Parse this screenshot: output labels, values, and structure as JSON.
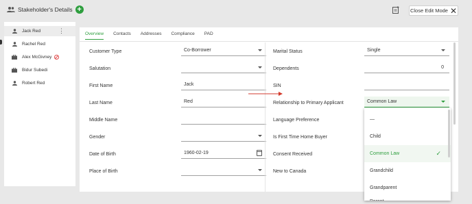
{
  "header": {
    "title": "Stakeholder's Details",
    "close_label": "Close Edit Mode"
  },
  "stakeholders": [
    {
      "name": "Jack Red",
      "icon": "person-icon",
      "selected": true
    },
    {
      "name": "Rachel Red",
      "icon": "person-icon"
    },
    {
      "name": "Alex McGivney",
      "icon": "briefcase-icon",
      "flag": "ban-icon"
    },
    {
      "name": "Bidur Subedi",
      "icon": "briefcase-icon"
    },
    {
      "name": "Robert Red",
      "icon": "person-icon"
    }
  ],
  "tabs": [
    "Overview",
    "Contacts",
    "Addresses",
    "Compliance",
    "PAD"
  ],
  "form": {
    "left": [
      {
        "label": "Customer Type",
        "value": "Co-Borrower",
        "dropdown": true
      },
      {
        "label": "Salutation",
        "value": "",
        "dropdown": true
      },
      {
        "label": "First Name",
        "value": "Jack"
      },
      {
        "label": "Last Name",
        "value": "Red"
      },
      {
        "label": "Middle Name",
        "value": ""
      },
      {
        "label": "Gender",
        "value": "",
        "dropdown": true
      },
      {
        "label": "Date of Birth",
        "value": "1960-02-19"
      },
      {
        "label": "Place of Birth",
        "value": "",
        "dropdown": true
      }
    ],
    "right": [
      {
        "label": "Marital Status",
        "value": "Single",
        "dropdown": true
      },
      {
        "label": "Dependents",
        "value": "0"
      },
      {
        "label": "SIN",
        "value": ""
      },
      {
        "label": "Relationship to Primary Applicant",
        "value": "Common Law",
        "dropdown": true
      },
      {
        "label": "Language Preference"
      },
      {
        "label": "Is First Time Home Buyer"
      },
      {
        "label": "Consent Received"
      },
      {
        "label": "New to Canada"
      }
    ]
  },
  "dropdown": {
    "options": [
      "—",
      "Child",
      "Common Law",
      "Grandchild",
      "Grandparent",
      "Parent"
    ],
    "selected": "Common Law"
  },
  "colors": {
    "accent": "#2e9e3e",
    "arrow": "#d33a2c"
  }
}
